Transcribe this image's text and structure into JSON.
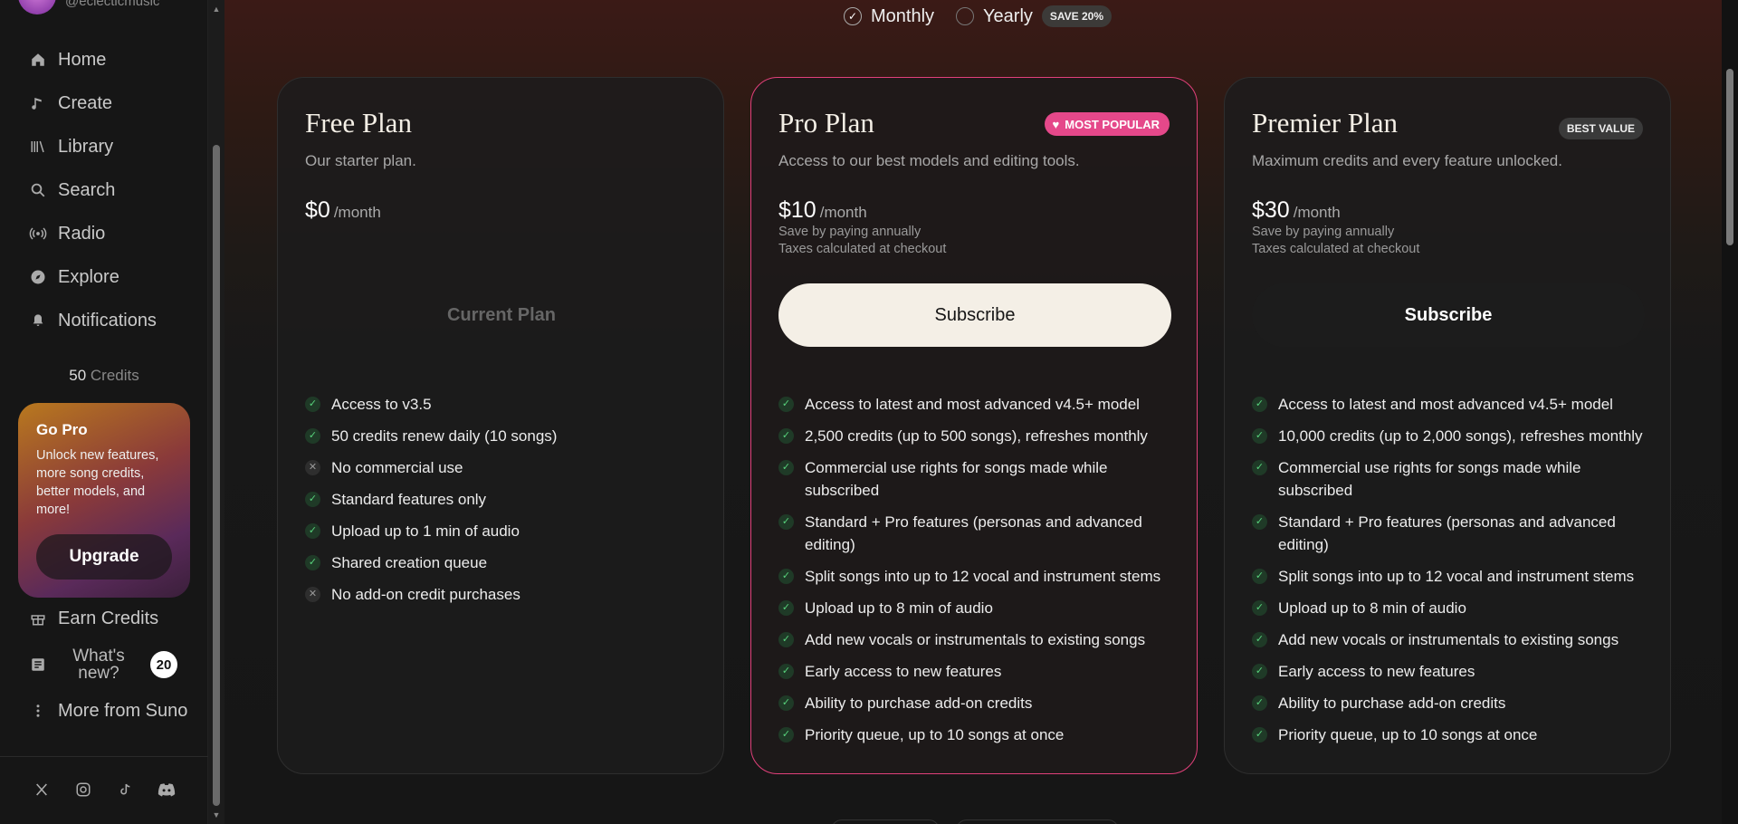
{
  "profile": {
    "handle": "@eclecticmusic"
  },
  "nav": [
    {
      "label": "Home",
      "icon": "home-icon"
    },
    {
      "label": "Create",
      "icon": "music-note-icon"
    },
    {
      "label": "Library",
      "icon": "library-icon"
    },
    {
      "label": "Search",
      "icon": "search-icon"
    },
    {
      "label": "Radio",
      "icon": "radio-icon"
    },
    {
      "label": "Explore",
      "icon": "compass-icon"
    },
    {
      "label": "Notifications",
      "icon": "bell-icon"
    }
  ],
  "credits": {
    "count": "50",
    "label": "Credits"
  },
  "gopro": {
    "title": "Go Pro",
    "text": "Unlock new features, more song credits, better models, and more!",
    "button": "Upgrade"
  },
  "secondary_nav": {
    "earn": "Earn Credits",
    "whats_new": "What's new?",
    "whats_new_count": "20",
    "more": "More from Suno"
  },
  "billing": {
    "monthly": "Monthly",
    "yearly": "Yearly",
    "save": "SAVE 20%",
    "selected": "Monthly"
  },
  "plans": [
    {
      "name": "Free Plan",
      "desc": "Our starter plan.",
      "price": "$0",
      "period": "/month",
      "note1": "",
      "note2": "",
      "button": "Current Plan",
      "badge": "",
      "features": [
        {
          "text": "Access to v3.5",
          "ok": true
        },
        {
          "text": "50 credits renew daily (10 songs)",
          "ok": true
        },
        {
          "text": "No commercial use",
          "ok": false
        },
        {
          "text": "Standard features only",
          "ok": true
        },
        {
          "text": "Upload up to 1 min of audio",
          "ok": true
        },
        {
          "text": "Shared creation queue",
          "ok": true
        },
        {
          "text": "No add-on credit purchases",
          "ok": false
        }
      ]
    },
    {
      "name": "Pro Plan",
      "desc": "Access to our best models and editing tools.",
      "price": "$10",
      "period": "/month",
      "note1": "Save by paying annually",
      "note2": "Taxes calculated at checkout",
      "button": "Subscribe",
      "badge": "MOST POPULAR",
      "features": [
        {
          "text": "Access to latest and most advanced v4.5+ model",
          "ok": true
        },
        {
          "text": "2,500 credits (up to 500 songs), refreshes monthly",
          "ok": true
        },
        {
          "text": "Commercial use rights for songs made while subscribed",
          "ok": true
        },
        {
          "text": "Standard + Pro features (personas and advanced editing)",
          "ok": true
        },
        {
          "text": "Split songs into up to 12 vocal and instrument stems",
          "ok": true
        },
        {
          "text": "Upload up to 8 min of audio",
          "ok": true
        },
        {
          "text": "Add new vocals or instrumentals to existing songs",
          "ok": true
        },
        {
          "text": "Early access to new features",
          "ok": true
        },
        {
          "text": "Ability to purchase add-on credits",
          "ok": true
        },
        {
          "text": "Priority queue, up to 10 songs at once",
          "ok": true
        }
      ]
    },
    {
      "name": "Premier Plan",
      "desc": "Maximum credits and every feature unlocked.",
      "price": "$30",
      "period": "/month",
      "note1": "Save by paying annually",
      "note2": "Taxes calculated at checkout",
      "button": "Subscribe",
      "badge": "BEST VALUE",
      "features": [
        {
          "text": "Access to latest and most advanced v4.5+ model",
          "ok": true
        },
        {
          "text": "10,000 credits (up to 2,000 songs), refreshes monthly",
          "ok": true
        },
        {
          "text": "Commercial use rights for songs made while subscribed",
          "ok": true
        },
        {
          "text": "Standard + Pro features (personas and advanced editing)",
          "ok": true
        },
        {
          "text": "Split songs into up to 12 vocal and instrument stems",
          "ok": true
        },
        {
          "text": "Upload up to 8 min of audio",
          "ok": true
        },
        {
          "text": "Add new vocals or instrumentals to existing songs",
          "ok": true
        },
        {
          "text": "Early access to new features",
          "ok": true
        },
        {
          "text": "Ability to purchase add-on credits",
          "ok": true
        },
        {
          "text": "Priority queue, up to 10 songs at once",
          "ok": true
        }
      ]
    }
  ],
  "colors": {
    "accent_pink": "#e5488a",
    "check_green": "#58d27c",
    "button_light": "#f4efe6"
  }
}
